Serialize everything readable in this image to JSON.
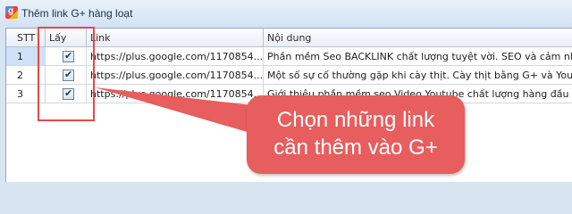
{
  "window": {
    "title": "Thêm link G+ hàng loạt",
    "icon": "google-plus-icon"
  },
  "grid": {
    "columns": [
      "STT",
      "Lấy",
      "Link",
      "Nội dung"
    ],
    "rows": [
      {
        "stt": "1",
        "checked": true,
        "link": "https://plus.google.com/1170854...",
        "content": "Phần mềm Seo BACKLINK chất lượng tuyệt vời. SEO và cảm nhận"
      },
      {
        "stt": "2",
        "checked": true,
        "link": "https://plus.google.com/1170854...",
        "content": "Một số sự cố thường gặp khi cày thịt. Cày thịt bằng G+ và Youtube"
      },
      {
        "stt": "3",
        "checked": true,
        "link": "https://plus.google.com/1170854...",
        "content": "Giới thiệu phần mềm seo Video Youtube chất lượng hàng đầu Việt"
      }
    ]
  },
  "annotation": {
    "line1": "Chọn những link",
    "line2": "cần thêm vào G+",
    "color": "#e85d5d"
  }
}
